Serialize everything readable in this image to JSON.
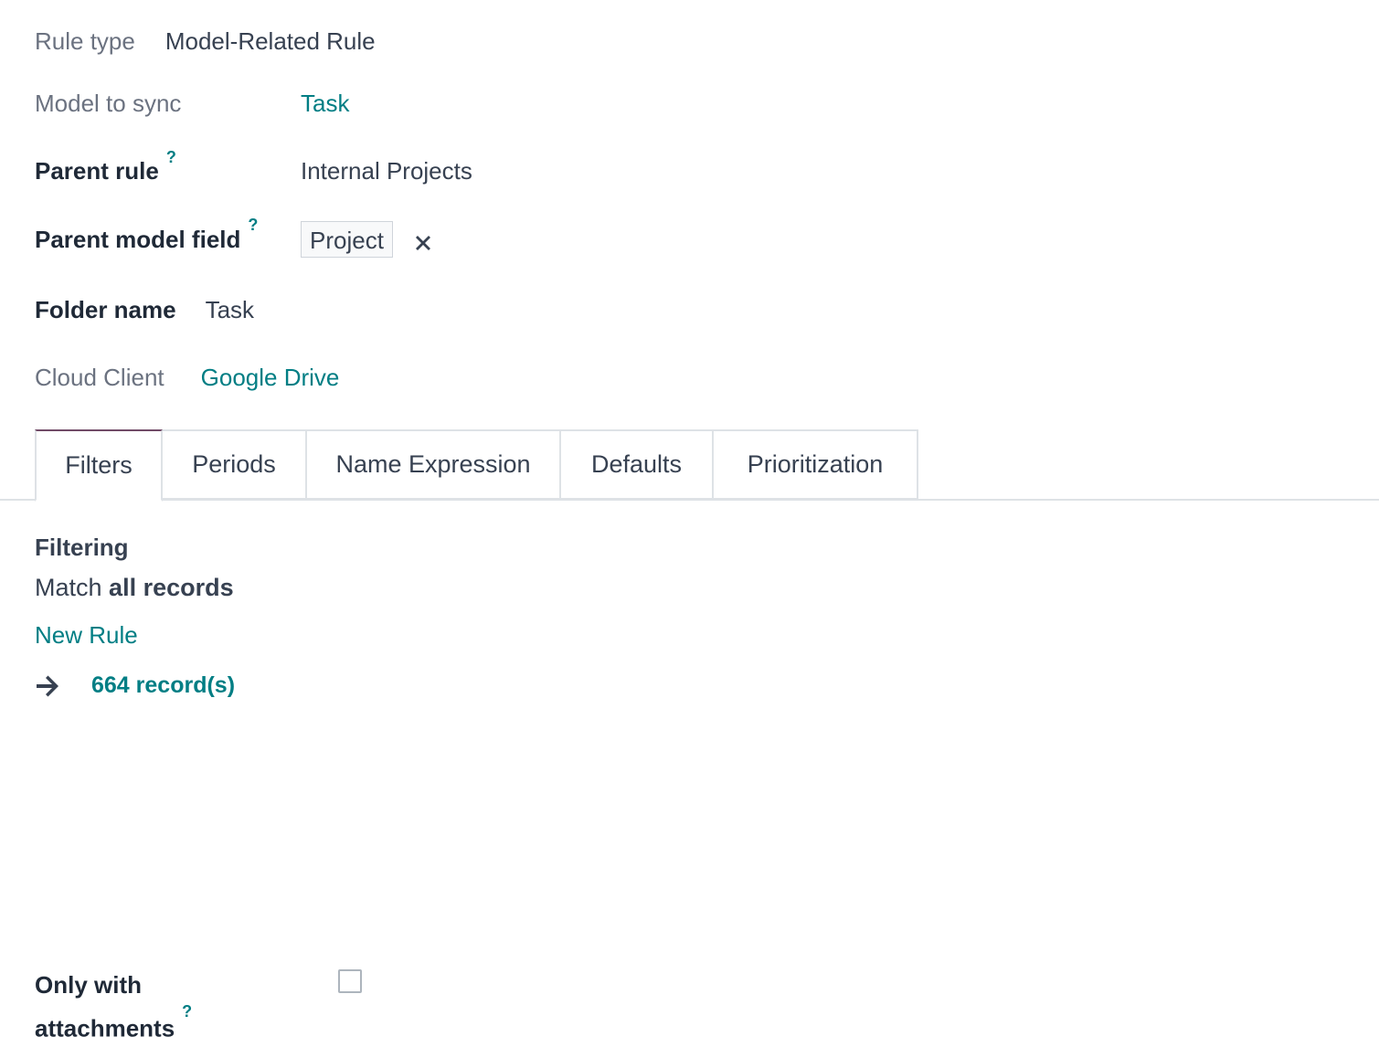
{
  "form": {
    "rule_type": {
      "label": "Rule type",
      "value": "Model-Related Rule"
    },
    "model_to_sync": {
      "label": "Model to sync",
      "value": "Task"
    },
    "parent_rule": {
      "label": "Parent rule",
      "help": "?",
      "value": "Internal Projects"
    },
    "parent_model_field": {
      "label": "Parent model field",
      "help": "?",
      "tag": "Project",
      "remove_icon": "close-x-icon"
    },
    "folder_name": {
      "label": "Folder name",
      "value": "Task"
    },
    "cloud_client": {
      "label": "Cloud Client",
      "value": "Google Drive"
    }
  },
  "tabs": [
    {
      "label": "Filters",
      "active": true
    },
    {
      "label": "Periods",
      "active": false
    },
    {
      "label": "Name Expression",
      "active": false
    },
    {
      "label": "Defaults",
      "active": false
    },
    {
      "label": "Prioritization",
      "active": false
    }
  ],
  "filters": {
    "section_title": "Filtering",
    "match_prefix": "Match",
    "match_bold": "all records",
    "new_rule": "New Rule",
    "arrow_icon": "arrow-right-icon",
    "records": "664 record(s)"
  },
  "only_with_attachments": {
    "label_line1": "Only with",
    "label_line2": "attachments",
    "help": "?",
    "checked": false
  },
  "colors": {
    "link": "#017e84",
    "active_tab_top": "#714b67",
    "muted_text": "#6b7280",
    "text": "#374151"
  }
}
